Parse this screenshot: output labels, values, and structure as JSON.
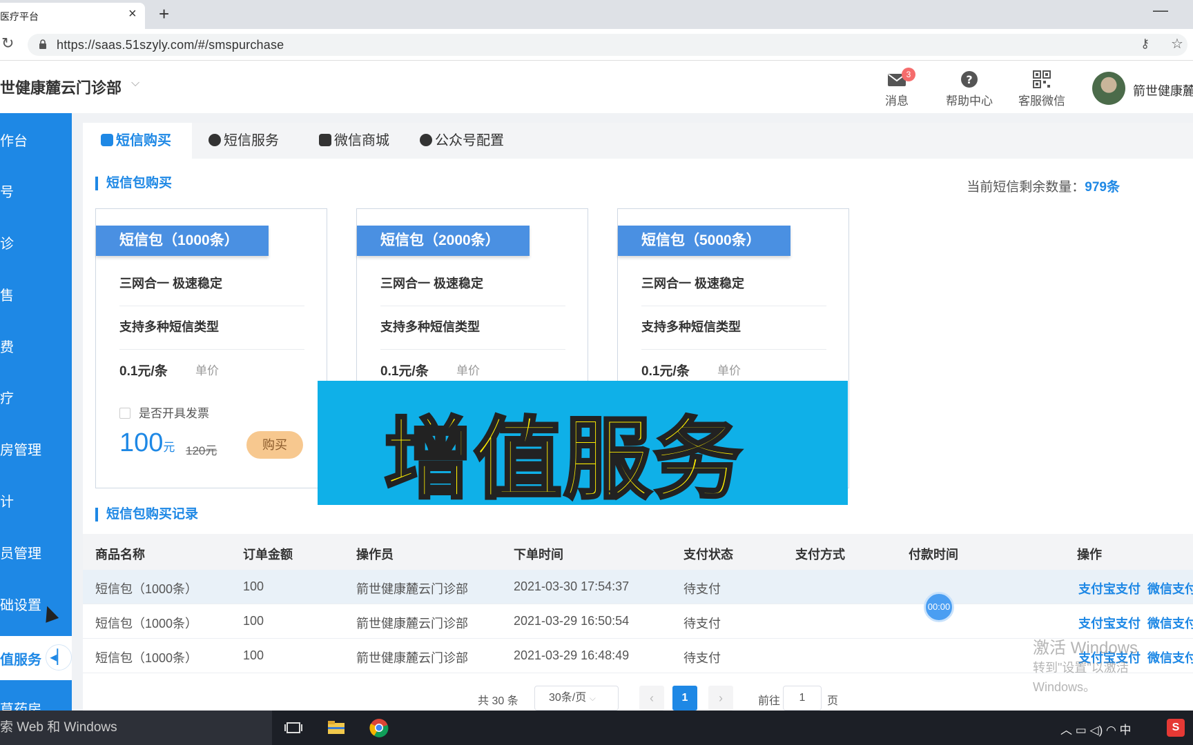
{
  "browser": {
    "tab_title": "医疗平台",
    "url": "https://saas.51szyly.com/#/smspurchase"
  },
  "header": {
    "clinic_name": "世健康麓云门诊部",
    "messages_label": "消息",
    "messages_count": "3",
    "help_label": "帮助中心",
    "service_label": "客服微信",
    "user_name": "箭世健康麓"
  },
  "sidebar": {
    "items": [
      {
        "label": "作台"
      },
      {
        "label": "号"
      },
      {
        "label": "诊"
      },
      {
        "label": "售"
      },
      {
        "label": "费"
      },
      {
        "label": "疗"
      },
      {
        "label": "房管理"
      },
      {
        "label": "计"
      },
      {
        "label": "员管理"
      },
      {
        "label": "础设置"
      },
      {
        "label": "值服务"
      },
      {
        "label": "草药房"
      }
    ]
  },
  "tabs": [
    {
      "label": "短信购买"
    },
    {
      "label": "短信服务"
    },
    {
      "label": "微信商城"
    },
    {
      "label": "公众号配置"
    }
  ],
  "purchase": {
    "section_title": "短信包购买",
    "remain_label": "当前短信剩余数量：",
    "remain_value": "979条",
    "packages": [
      {
        "name": "短信包（1000条）",
        "feature1": "三网合一 极速稳定",
        "feature2": "支持多种短信类型",
        "unit_price": "0.1元/条",
        "unit_label": "单价",
        "invoice_label": "是否开具发票",
        "price": "100",
        "currency": "元",
        "old_price": "120元",
        "buy_label": "购买"
      },
      {
        "name": "短信包（2000条）",
        "feature1": "三网合一 极速稳定",
        "feature2": "支持多种短信类型",
        "unit_price": "0.1元/条",
        "unit_label": "单价"
      },
      {
        "name": "短信包（5000条）",
        "feature1": "三网合一 极速稳定",
        "feature2": "支持多种短信类型",
        "unit_price": "0.1元/条",
        "unit_label": "单价"
      }
    ]
  },
  "overlay": {
    "text": "增值服务"
  },
  "records": {
    "section_title": "短信包购买记录",
    "columns": [
      "商品名称",
      "订单金额",
      "操作员",
      "下单时间",
      "支付状态",
      "支付方式",
      "付款时间",
      "操作"
    ],
    "rows": [
      {
        "name": "短信包（1000条）",
        "amount": "100",
        "operator": "箭世健康麓云门诊部",
        "time": "2021-03-30 17:54:37",
        "status": "待支付",
        "alipay": "支付宝支付",
        "wechat": "微信支付"
      },
      {
        "name": "短信包（1000条）",
        "amount": "100",
        "operator": "箭世健康麓云门诊部",
        "time": "2021-03-29 16:50:54",
        "status": "待支付",
        "alipay": "支付宝支付",
        "wechat": "微信支付"
      },
      {
        "name": "短信包（1000条）",
        "amount": "100",
        "operator": "箭世健康麓云门诊部",
        "time": "2021-03-29 16:48:49",
        "status": "待支付",
        "alipay": "支付宝支付",
        "wechat": "微信支付"
      }
    ]
  },
  "pager": {
    "total": "共 30 条",
    "page_size": "30条/页",
    "current": "1",
    "goto_prefix": "前往",
    "goto_value": "1",
    "goto_suffix": "页"
  },
  "timer": "00:00",
  "watermark": {
    "line1": "激活 Windows",
    "line2": "转到\"设置\"以激活 Windows。"
  },
  "taskbar": {
    "search": "索 Web 和 Windows",
    "ime": "中"
  },
  "colors": {
    "primary": "#1e88e5",
    "overlay_bg": "#0fb0e8",
    "overlay_text": "#ffee00"
  }
}
